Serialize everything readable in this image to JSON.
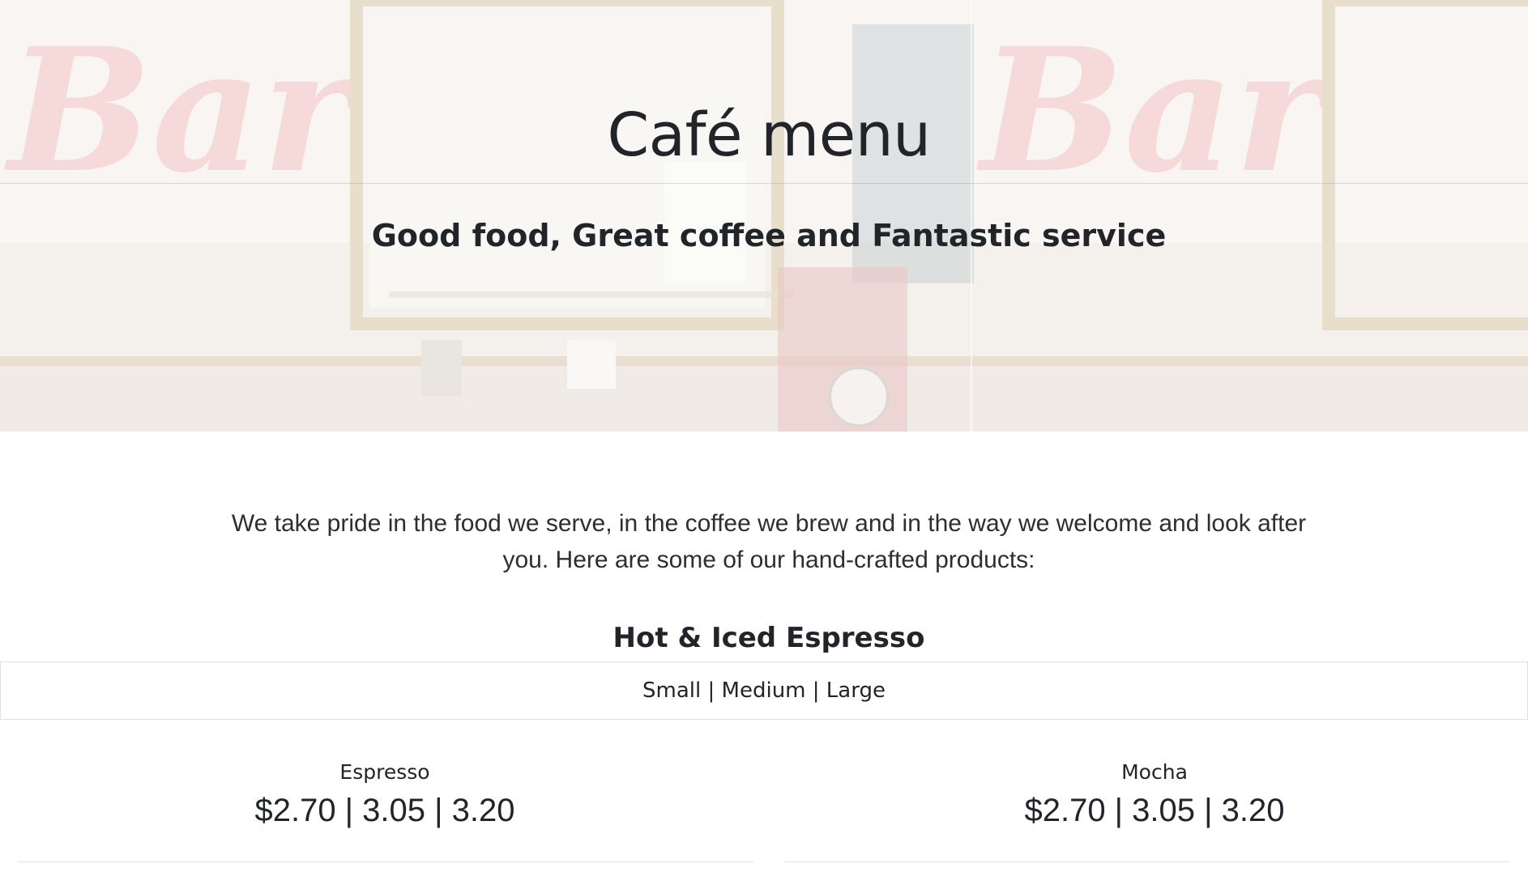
{
  "hero": {
    "title": "Café menu",
    "subtitle": "Good food, Great coffee and Fantastic service"
  },
  "intro": "We take pride in the food we serve, in the coffee we brew and in the way we welcome and look after you. Here are some of our hand-crafted products:",
  "section": {
    "title": "Hot & Iced Espresso",
    "sizes": "Small | Medium | Large"
  },
  "items": [
    {
      "name": "Espresso",
      "price": "$2.70 | 3.05 | 3.20"
    },
    {
      "name": "Mocha",
      "price": "$2.70 | 3.05 | 3.20"
    }
  ]
}
